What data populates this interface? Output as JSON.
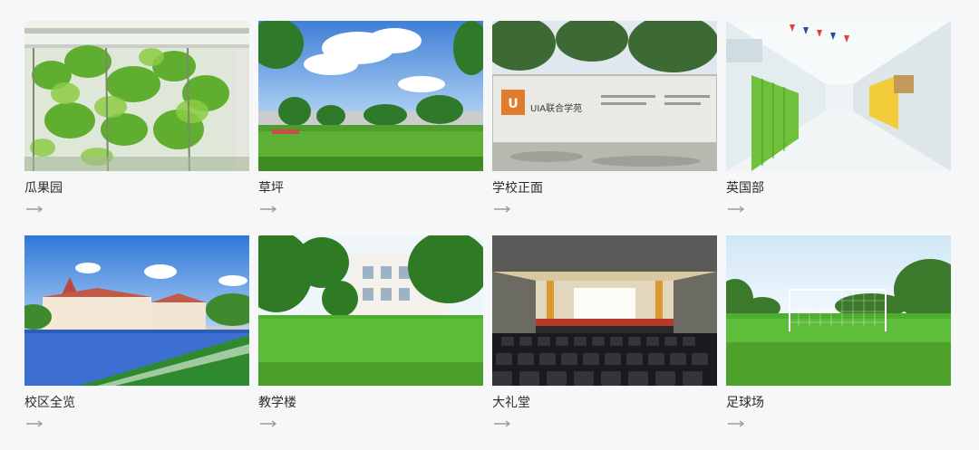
{
  "gallery": {
    "items": [
      {
        "label": "瓜果园",
        "scene": "garden"
      },
      {
        "label": "草坪",
        "scene": "lawn"
      },
      {
        "label": "学校正面",
        "scene": "school-front",
        "sign_text": "UIA联合学苑"
      },
      {
        "label": "英国部",
        "scene": "corridor"
      },
      {
        "label": "校区全览",
        "scene": "campus-overview"
      },
      {
        "label": "教学楼",
        "scene": "teaching-building"
      },
      {
        "label": "大礼堂",
        "scene": "auditorium"
      },
      {
        "label": "足球场",
        "scene": "football-field"
      }
    ],
    "arrow_icon": "arrow-right-icon"
  }
}
